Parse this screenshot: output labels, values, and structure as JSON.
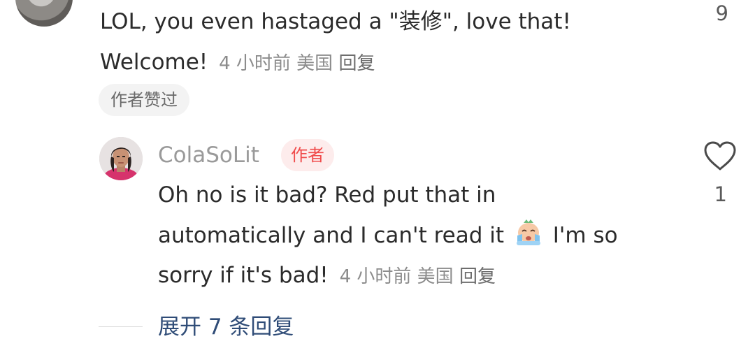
{
  "top_comment": {
    "text_line1": "LOL, you even hastaged a \"装修\", love that!",
    "text_line2": "Welcome!",
    "time": "4 小时前",
    "location": "美国",
    "reply_label": "回复",
    "like_count": "9",
    "author_liked_label": "作者赞过"
  },
  "reply_comment": {
    "username": "ColaSoLit",
    "author_badge": "作者",
    "line1": "Oh no is it bad? Red put that in",
    "line2_before_emoji": "automatically and I can't read it",
    "line2_after_emoji": "I'm so",
    "line3": "sorry if it's bad!",
    "time": "4 小时前",
    "location": "美国",
    "reply_label": "回复",
    "like_count": "1",
    "emoji_icon": "crying-face-emoji"
  },
  "expand_replies": {
    "label": "展开 7 条回复"
  },
  "colors": {
    "author_badge_bg": "#fdecec",
    "author_badge_text": "#f04b4b",
    "expand_link": "#2f4c77"
  }
}
